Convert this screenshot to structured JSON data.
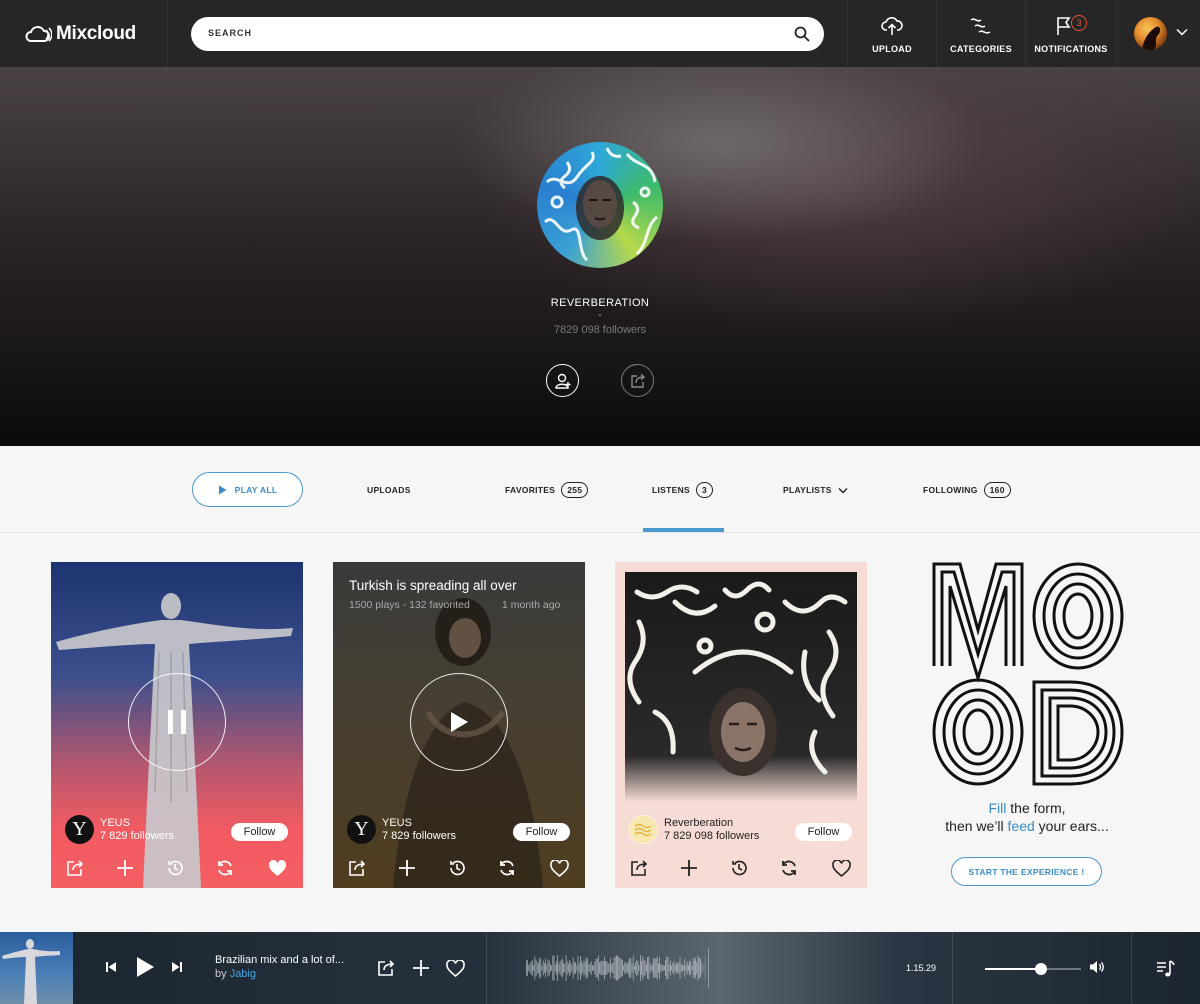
{
  "nav": {
    "logo": "Mixcloud",
    "search_placeholder": "SEARCH",
    "upload_label": "UPLOAD",
    "categories_label": "CATEGORIES",
    "notifications_label": "NOTIFICATIONS",
    "notifications_count": "3"
  },
  "profile": {
    "name": "REVERBERATION",
    "dash": "-",
    "followers": "7829 098 followers"
  },
  "tabs": {
    "play_all": "PLAY ALL",
    "uploads": "UPLOADS",
    "favorites": "FAVORITES",
    "favorites_count": "255",
    "listens": "LISTENS",
    "listens_count": "3",
    "playlists": "PLAYLISTS",
    "following": "FOLLOWING",
    "following_count": "160",
    "active": "listens"
  },
  "cards": [
    {
      "owner_name": "YEUS",
      "owner_followers": "7 829 followers",
      "follow_label": "Follow",
      "avatar_letter": "Y",
      "state": "playing"
    },
    {
      "title": "Turkish is spreading all over",
      "meta": "1500 plays - 132 favorited",
      "meta_time": "1 month ago",
      "owner_name": "YEUS",
      "owner_followers": "7 829 followers",
      "follow_label": "Follow",
      "avatar_letter": "Y",
      "state": "paused"
    },
    {
      "owner_name": "Reverberation",
      "owner_followers": "7 829 098 followers",
      "follow_label": "Follow",
      "state": "idle"
    }
  ],
  "promo": {
    "art_word_top": "MO",
    "art_word_bottom": "OD",
    "line1_highlight": "Fill",
    "line1_rest": " the form,",
    "line2_start": "then we’ll ",
    "line2_highlight": "feed",
    "line2_rest": " your ears...",
    "cta": "START THE EXPERIENCE !"
  },
  "player": {
    "title": "Brazilian mix and a lot of...",
    "by_prefix": "by ",
    "artist": "Jabig",
    "time": "1.15.29",
    "volume": 0.58
  },
  "colors": {
    "accent": "#4a9ad0",
    "notification": "#e94b3c",
    "nav_bg": "#262626"
  }
}
